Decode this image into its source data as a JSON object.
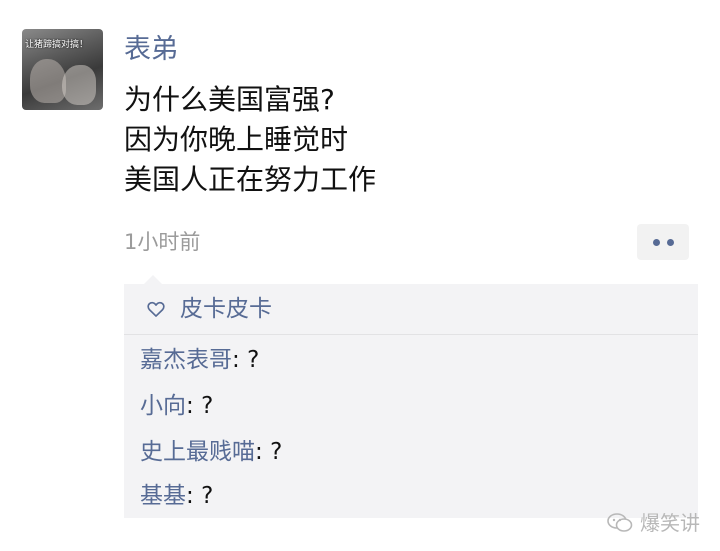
{
  "post": {
    "avatar_caption": "让猪蹄搞对搞！",
    "author": "表弟",
    "content_lines": [
      "为什么美国富强?",
      "因为你晚上睡觉时",
      "美国人正在努力工作"
    ],
    "time": "1小时前"
  },
  "likes": {
    "icon": "heart-outline-icon",
    "names": "皮卡皮卡"
  },
  "comments": [
    {
      "author": "嘉杰表哥",
      "sep": ": ",
      "text": "?"
    },
    {
      "author": "小向",
      "sep": ": ",
      "text": "?"
    },
    {
      "author": "史上最贱喵",
      "sep": ": ",
      "text": "?"
    },
    {
      "author": "基基",
      "sep": ": ",
      "text": "?"
    }
  ],
  "watermark": {
    "text": "爆笑讲"
  },
  "colors": {
    "link": "#576b95",
    "text": "#111111",
    "muted": "#9b9b9b",
    "panel": "#f3f3f5"
  }
}
